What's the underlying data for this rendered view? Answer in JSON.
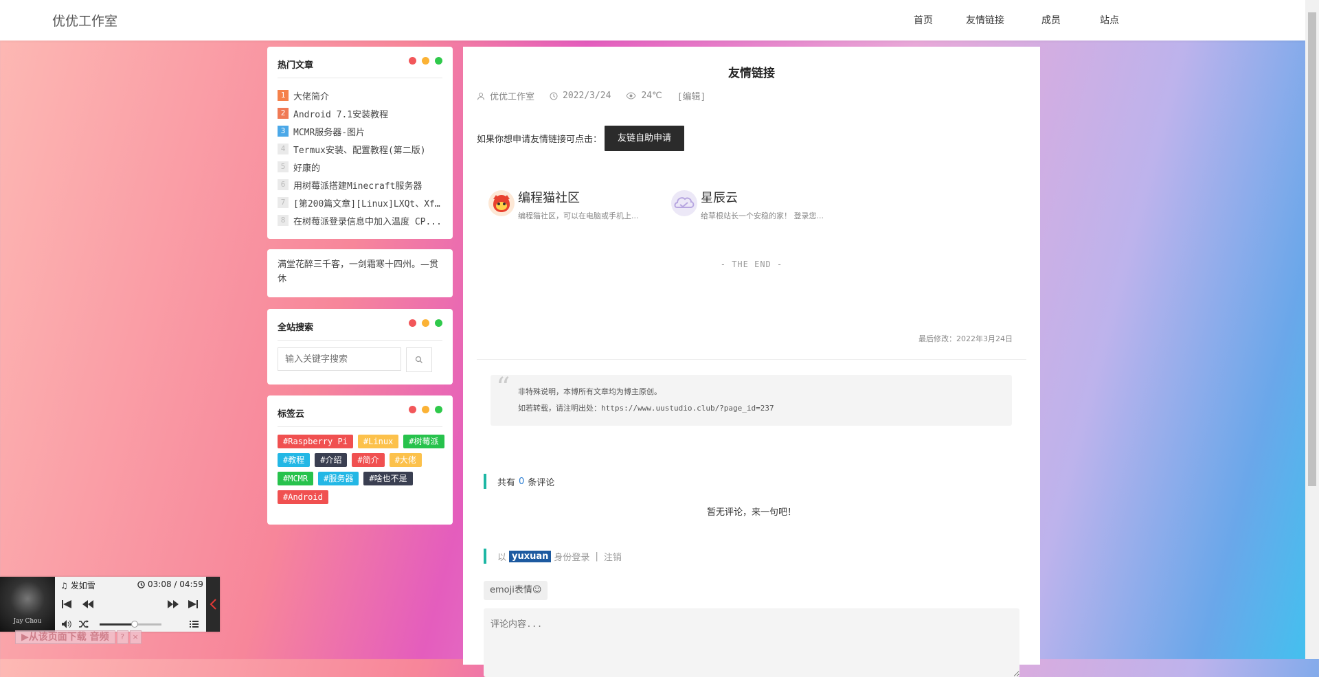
{
  "header": {
    "logo": "优优工作室",
    "nav": [
      "首页",
      "友情链接",
      "成员",
      "站点"
    ]
  },
  "hot": {
    "title": "热门文章",
    "items": [
      {
        "rank": "1",
        "title": "大佬简介"
      },
      {
        "rank": "2",
        "title": "Android 7.1安装教程"
      },
      {
        "rank": "3",
        "title": "MCMR服务器-图片"
      },
      {
        "rank": "4",
        "title": "Termux安装、配置教程(第二版)"
      },
      {
        "rank": "5",
        "title": "好康的"
      },
      {
        "rank": "6",
        "title": "用树莓派搭建Minecraft服务器"
      },
      {
        "rank": "7",
        "title": "[第200篇文章][Linux]LXQt、Xf..."
      },
      {
        "rank": "8",
        "title": "在树莓派登录信息中加入温度 CP..."
      }
    ]
  },
  "quote": {
    "text": "满堂花醉三千客，一剑霜寒十四州。—贯休"
  },
  "search": {
    "title": "全站搜索",
    "placeholder": "输入关键字搜索"
  },
  "tags": {
    "title": "标签云",
    "items": [
      {
        "label": "#Raspberry Pi",
        "color": "#f05050"
      },
      {
        "label": "#Linux",
        "color": "#fcc14b"
      },
      {
        "label": "#树莓派",
        "color": "#27c24c"
      },
      {
        "label": "#教程",
        "color": "#23b7e5"
      },
      {
        "label": "#介绍",
        "color": "#3a3f51"
      },
      {
        "label": "#简介",
        "color": "#f05050"
      },
      {
        "label": "#大佬",
        "color": "#fcc14b"
      },
      {
        "label": "#MCMR",
        "color": "#27c24c"
      },
      {
        "label": "#服务器",
        "color": "#23b7e5"
      },
      {
        "label": "#啥也不是",
        "color": "#3a3f51"
      },
      {
        "label": "#Android",
        "color": "#f05050"
      }
    ]
  },
  "post": {
    "title": "友情链接",
    "author": "优优工作室",
    "date": "2022/3/24",
    "views": "24℃",
    "edit": "[编辑]",
    "apply_text": "如果你想申请友情链接可点击：",
    "apply_button": "友链自助申请",
    "links": [
      {
        "name": "编程猫社区",
        "desc": "编程猫社区，可以在电脑或手机上..."
      },
      {
        "name": "星辰云",
        "desc": "给草根站长一个安稳的家！ 登录您..."
      }
    ],
    "the_end": "- THE END -",
    "modified": "最后修改：2022年3月24日",
    "copyright_line1": "非特殊说明，本博所有文章均为博主原创。",
    "copyright_line2": "如若转载，请注明出处：https://www.uustudio.club/?page_id=237"
  },
  "comments": {
    "prefix": "共有",
    "count": "0",
    "suffix": "条评论",
    "empty": "暂无评论，来一句吧！",
    "login_prefix": "以",
    "user": "yuxuan",
    "login_suffix": "身份登录",
    "sep": "|",
    "logout": "注销",
    "emoji": "emoji表情☺",
    "placeholder": "评论内容..."
  },
  "player": {
    "song": "发如雪",
    "time": "03:08 / 04:59",
    "cover_text": "Jay Chou",
    "volume_percent": 55
  },
  "download": {
    "label": "▶从该页面下载 音频",
    "help": "?",
    "close": "×"
  }
}
